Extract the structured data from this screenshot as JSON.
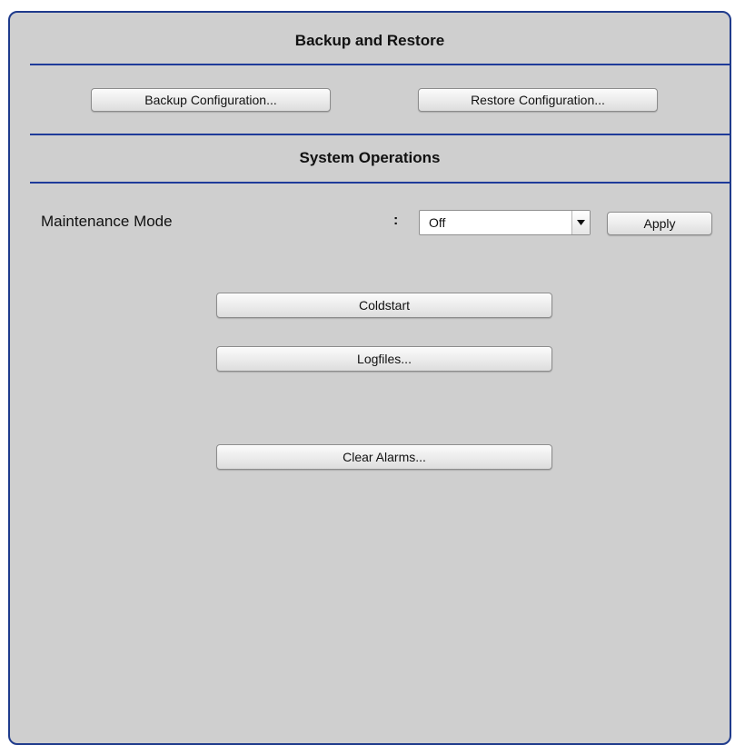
{
  "backup_restore": {
    "title": "Backup and Restore",
    "backup_button": "Backup Configuration...",
    "restore_button": "Restore Configuration..."
  },
  "system_operations": {
    "title": "System Operations",
    "maintenance_mode": {
      "label": "Maintenance Mode",
      "separator": ":",
      "selected": "Off",
      "apply_button": "Apply"
    },
    "coldstart_button": "Coldstart",
    "logfiles_button": "Logfiles...",
    "clear_alarms_button": "Clear Alarms..."
  },
  "colors": {
    "panel_background": "#cfcfcf",
    "divider": "#1f3b9a",
    "border": "#1f3b8c"
  },
  "icons": {
    "dropdown": "chevron-down-icon"
  }
}
